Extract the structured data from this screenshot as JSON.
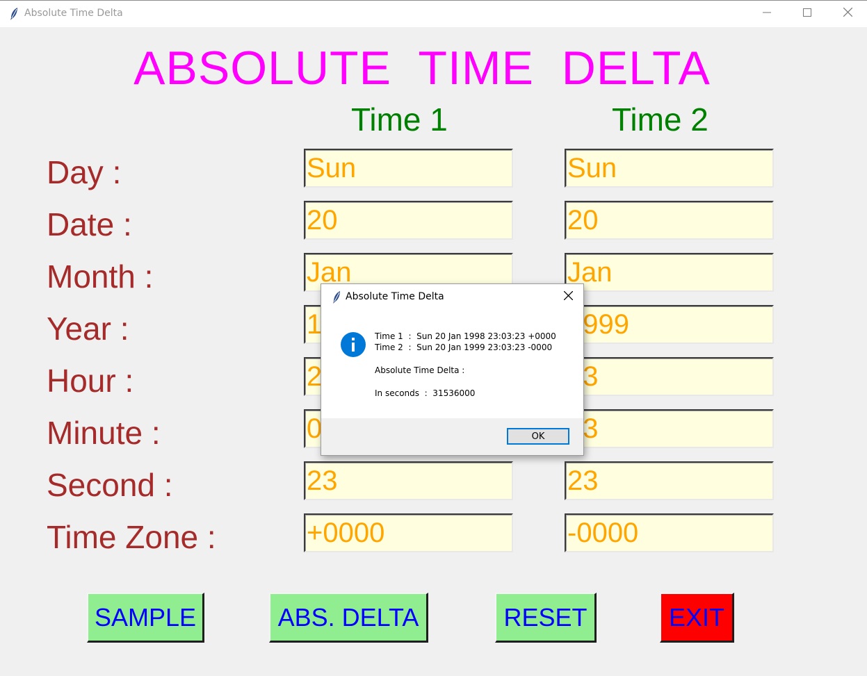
{
  "window": {
    "title": "Absolute Time Delta"
  },
  "app": {
    "heading": "ABSOLUTE  TIME  DELTA",
    "columns": [
      "Time 1",
      "Time 2"
    ],
    "rows": [
      {
        "label": "Day :",
        "time1": "Sun",
        "time2": "Sun"
      },
      {
        "label": "Date :",
        "time1": "20",
        "time2": "20"
      },
      {
        "label": "Month :",
        "time1": "Jan",
        "time2": "Jan"
      },
      {
        "label": "Year :",
        "time1": "1998",
        "time2": "1999"
      },
      {
        "label": "Hour :",
        "time1": "23",
        "time2": "23"
      },
      {
        "label": "Minute :",
        "time1": "03",
        "time2": "03"
      },
      {
        "label": "Second :",
        "time1": "23",
        "time2": "23"
      },
      {
        "label": "Time Zone :",
        "time1": "+0000",
        "time2": "-0000"
      }
    ],
    "buttons": {
      "sample": "SAMPLE",
      "abs_delta": "ABS. DELTA",
      "reset": "RESET",
      "exit": "EXIT"
    }
  },
  "dialog": {
    "title": "Absolute Time Delta",
    "line_time1": "Time 1  :  Sun 20 Jan 1998 23:03:23 +0000",
    "line_time2": "Time 2  :  Sun 20 Jan 1999 23:03:23 -0000",
    "line_delta": "Absolute Time Delta :",
    "line_seconds": "In seconds  :  31536000",
    "ok_label": "OK",
    "icon": "info-icon"
  },
  "colors": {
    "heading": "#ff00ff",
    "column_heading": "#008000",
    "row_label": "#a52a2a",
    "field_bg": "#ffffe0",
    "field_text": "#ffa500",
    "button_bg": "#90ee90",
    "button_text": "#0000ff",
    "exit_bg": "#ff0000",
    "info_icon": "#0078d7"
  }
}
